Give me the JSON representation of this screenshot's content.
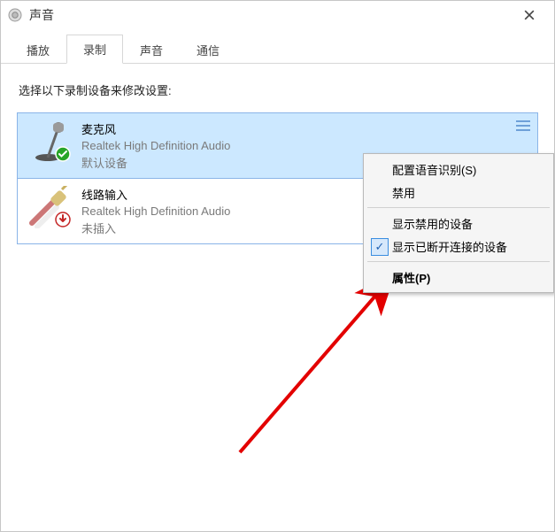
{
  "window": {
    "title": "声音"
  },
  "tabs": {
    "items": [
      {
        "label": "播放"
      },
      {
        "label": "录制"
      },
      {
        "label": "声音"
      },
      {
        "label": "通信"
      }
    ],
    "activeIndex": 1
  },
  "prompt": "选择以下录制设备来修改设置:",
  "devices": [
    {
      "name": "麦克风",
      "sub": "Realtek High Definition Audio",
      "status": "默认设备",
      "selected": true,
      "iconKind": "mic",
      "overlay": "ok"
    },
    {
      "name": "线路输入",
      "sub": "Realtek High Definition Audio",
      "status": "未插入",
      "selected": false,
      "iconKind": "line",
      "overlay": "down"
    }
  ],
  "context_menu": {
    "items": [
      {
        "label": "配置语音识别(S)",
        "type": "item"
      },
      {
        "label": "禁用",
        "type": "item"
      },
      {
        "type": "sep"
      },
      {
        "label": "显示禁用的设备",
        "type": "item"
      },
      {
        "label": "显示已断开连接的设备",
        "type": "item",
        "checked": true
      },
      {
        "type": "sep"
      },
      {
        "label": "属性(P)",
        "type": "item",
        "bold": true
      }
    ]
  }
}
